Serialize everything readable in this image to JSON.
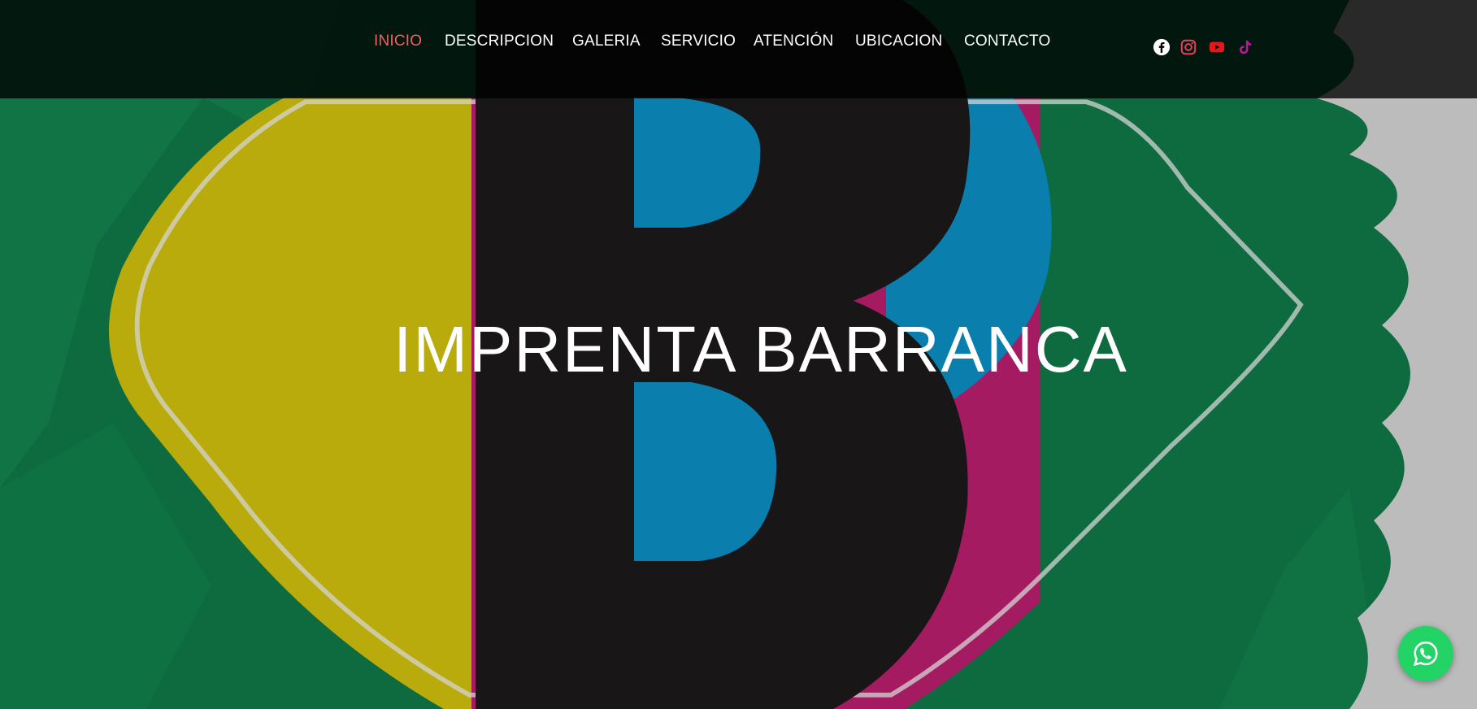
{
  "nav": {
    "items": [
      {
        "label": "INICIO",
        "active": true
      },
      {
        "label": "DESCRIPCION",
        "active": false
      },
      {
        "label": "GALERIA",
        "active": false
      },
      {
        "label": "SERVICIO",
        "active": false
      },
      {
        "label": "ATENCIÓN",
        "active": false
      },
      {
        "label": "UBICACION",
        "active": false
      },
      {
        "label": "CONTACTO",
        "active": false
      }
    ],
    "active_color": "#f0605f"
  },
  "social": [
    {
      "icon": "facebook-icon",
      "color": "#ffffff"
    },
    {
      "icon": "instagram-icon",
      "color": "#e4405f"
    },
    {
      "icon": "youtube-icon",
      "color": "#e11b1b"
    },
    {
      "icon": "tiktok-icon",
      "color": "#b9189a"
    }
  ],
  "hero": {
    "title": "IMPRENTA BARRANCA"
  },
  "whatsapp": {
    "icon": "whatsapp-icon",
    "color": "#24d366"
  },
  "palette": {
    "yellow": "#b8ab0b",
    "black": "#181617",
    "cyan": "#0a7ead",
    "magenta": "#a41b62",
    "green": "#0d6b3f"
  }
}
